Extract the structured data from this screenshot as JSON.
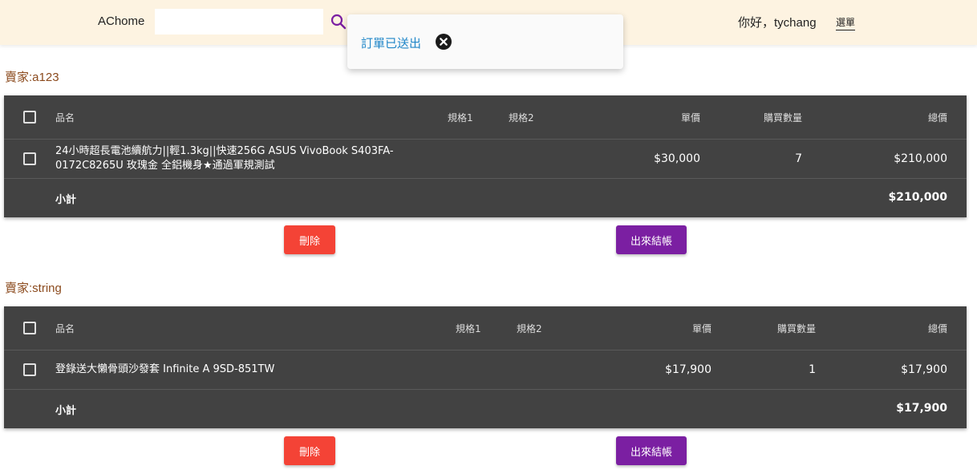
{
  "header": {
    "brand": "AChome",
    "search_placeholder": "",
    "search_icon": "search-icon",
    "greeting": "你好，tychang",
    "menu_label": "選單"
  },
  "toast": {
    "message": "訂單已送出",
    "close_icon": "close-circle-icon"
  },
  "colors": {
    "header_bg": "#fdf3e1",
    "table_bg": "#424242",
    "seller_label": "#8b4a1d",
    "toast_text": "#1f86c8",
    "delete_button": "#f44336",
    "checkout_button": "#7b1fa2",
    "search_icon": "#7b1fa2"
  },
  "carts": [
    {
      "seller_label": "賣家:a123",
      "columns": {
        "name": "品名",
        "spec1": "規格1",
        "spec2": "規格2",
        "unit_price": "單價",
        "quantity": "購買數量",
        "total": "總價"
      },
      "items": [
        {
          "name": "24小時超長電池續航力||輕1.3kg||快速256G ASUS VivoBook S403FA-0172C8265U 玫瑰金 全鋁機身★通過軍規測試",
          "spec1": "",
          "spec2": "",
          "unit_price": "$30,000",
          "quantity": "7",
          "total": "$210,000"
        }
      ],
      "subtotal_label": "小計",
      "subtotal_value": "$210,000",
      "delete_label": "刪除",
      "checkout_label": "出來結帳"
    },
    {
      "seller_label": "賣家:string",
      "columns": {
        "name": "品名",
        "spec1": "規格1",
        "spec2": "規格2",
        "unit_price": "單價",
        "quantity": "購買數量",
        "total": "總價"
      },
      "items": [
        {
          "name": "登錄送大懶骨頭沙發套 Infinite A 9SD-851TW",
          "spec1": "",
          "spec2": "",
          "unit_price": "$17,900",
          "quantity": "1",
          "total": "$17,900"
        }
      ],
      "subtotal_label": "小計",
      "subtotal_value": "$17,900",
      "delete_label": "刪除",
      "checkout_label": "出來結帳"
    }
  ]
}
